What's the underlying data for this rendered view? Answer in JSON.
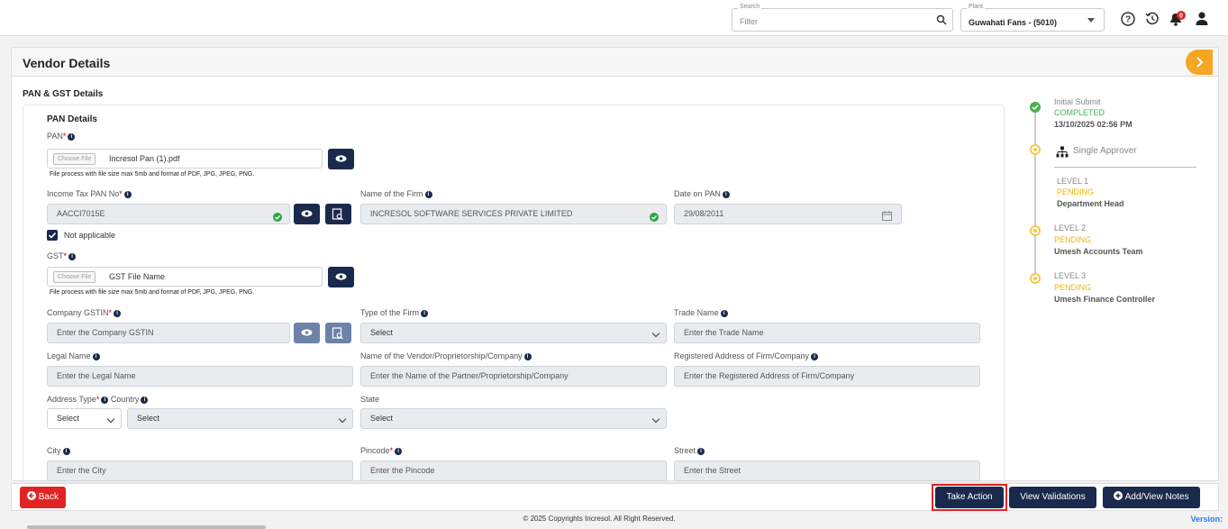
{
  "topbar": {
    "search_legend": "Search",
    "search_placeholder": "Filter",
    "plant_legend": "Plant",
    "plant_value": "Guwahati Fans - (5010)",
    "notification_count": "0"
  },
  "page": {
    "title": "Vendor Details",
    "section_title": "PAN & GST Details",
    "subsection_title": "PAN Details"
  },
  "form": {
    "pan_label": "PAN",
    "pan_file_button": "Choose File",
    "pan_file_name": "Incresol Pan (1).pdf",
    "file_hint": "File process with file size max 5mb and format of PDF, JPG, JPEG, PNG.",
    "income_tax_pan_label": "Income Tax PAN No",
    "income_tax_pan_value": "AACCI7015E",
    "firm_name_label": "Name of the Firm",
    "firm_name_value": "INCRESOL SOFTWARE SERVICES PRIVATE LIMITED",
    "date_on_pan_label": "Date on PAN",
    "date_on_pan_value": "29/08/2011",
    "not_applicable_label": "Not applicable",
    "gst_label": "GST",
    "gst_file_button": "Choose File",
    "gst_file_name": "GST File Name",
    "company_gstin_label": "Company GSTIN",
    "company_gstin_placeholder": "Enter the Company GSTIN",
    "type_of_firm_label": "Type of the Firm",
    "type_of_firm_value": "Select",
    "trade_name_label": "Trade Name",
    "trade_name_placeholder": "Enter the Trade Name",
    "legal_name_label": "Legal Name",
    "legal_name_placeholder": "Enter the Legal Name",
    "vendor_name_label": "Name of the Vendor/Proprietorship/Company",
    "vendor_name_placeholder": "Enter the Name of the Partner/Proprietorship/Company",
    "registered_address_label": "Registered Address of Firm/Company",
    "registered_address_placeholder": "Enter the Registered Address of Firm/Company",
    "address_type_label": "Address Type",
    "address_type_value": "Select",
    "country_label": "Country",
    "country_value": "Select",
    "state_label": "State",
    "state_value": "Select",
    "city_label": "City",
    "city_placeholder": "Enter the City",
    "pincode_label": "Pincode",
    "pincode_placeholder": "Enter the Pincode",
    "street_label": "Street",
    "street_placeholder": "Enter the Street"
  },
  "timeline": {
    "initial_title": "Initial Submit",
    "initial_status": "COMPLETED",
    "initial_date": "13/10/2025 02:56 PM",
    "approver_type": "Single Approver",
    "levels": [
      {
        "level": "LEVEL 1",
        "status": "PENDING",
        "role": "Department Head"
      },
      {
        "level": "LEVEL 2",
        "status": "PENDING",
        "role": "Umesh Accounts Team"
      },
      {
        "level": "LEVEL 3",
        "status": "PENDING",
        "role": "Umesh Finance Controller"
      }
    ]
  },
  "actions": {
    "back": "Back",
    "take_action": "Take Action",
    "view_validations": "View Validations",
    "add_view_notes": "Add/View Notes"
  },
  "footer": {
    "copyright": "© 2025 Copyrights Incresol. All Right Reserved.",
    "version": "Version:"
  },
  "colors": {
    "navy": "#1a2a4d",
    "accent_orange": "#f5a623",
    "success_green": "#4caf50",
    "pending_yellow": "#f5b400",
    "danger_red": "#e02424"
  },
  "icons": [
    "search-icon",
    "help-icon",
    "history-icon",
    "bell-icon",
    "user-icon",
    "chevron-right-icon",
    "info-icon",
    "eye-icon",
    "document-search-icon",
    "check-circle-icon",
    "calendar-icon",
    "hierarchy-icon",
    "plus-circle-icon",
    "arrow-left-circle-icon"
  ]
}
